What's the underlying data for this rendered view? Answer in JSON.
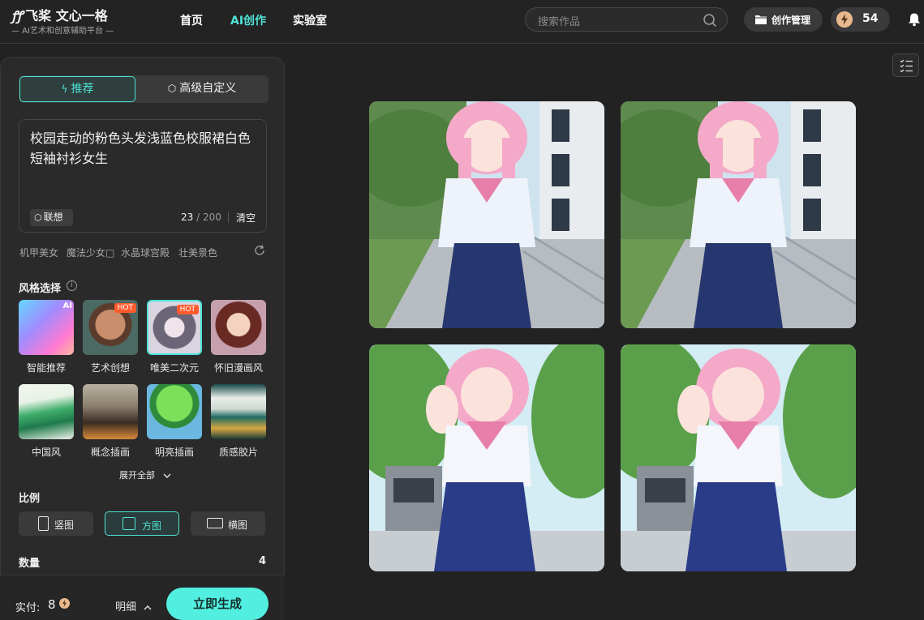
{
  "header": {
    "logo_mark": "ꝭꝭ",
    "logo_title": "飞桨 文心一格",
    "logo_subtitle": "— AI艺术和创意辅助平台 —",
    "nav": [
      {
        "label": "首页",
        "active": false
      },
      {
        "label": "AI创作",
        "active": true
      },
      {
        "label": "实验室",
        "active": false
      }
    ],
    "search_placeholder": "搜索作品",
    "manage_label": "创作管理",
    "energy_value": "54"
  },
  "panel": {
    "tabs": [
      {
        "label": "推荐",
        "icon": "bolt-icon",
        "active": true
      },
      {
        "label": "高级自定义",
        "icon": "cube-icon",
        "active": false
      }
    ],
    "prompt_text": "校园走动的粉色头发浅蓝色校服裙白色短袖衬衫女生",
    "associate_label": "联想",
    "char_count": "23",
    "char_max": "/ 200",
    "clear_label": "清空",
    "suggestions": [
      "机甲美女",
      "魔法少女□",
      "水晶球宫殿",
      "壮美景色"
    ],
    "style_title": "风格选择",
    "styles": [
      {
        "label": "智能推荐",
        "badge": "AI",
        "selected": false
      },
      {
        "label": "艺术创想",
        "badge": "HOT",
        "selected": false
      },
      {
        "label": "唯美二次元",
        "badge": "HOT",
        "selected": true
      },
      {
        "label": "怀旧漫画风",
        "badge": "",
        "selected": false
      },
      {
        "label": "中国风",
        "badge": "",
        "selected": false
      },
      {
        "label": "概念插画",
        "badge": "",
        "selected": false
      },
      {
        "label": "明亮插画",
        "badge": "",
        "selected": false
      },
      {
        "label": "质感胶片",
        "badge": "",
        "selected": false
      }
    ],
    "expand_label": "展开全部",
    "ratio_title": "比例",
    "ratios": [
      {
        "label": "竖图",
        "selected": false
      },
      {
        "label": "方图",
        "selected": true
      },
      {
        "label": "横图",
        "selected": false
      }
    ],
    "quantity_title": "数量",
    "quantity_value": "4"
  },
  "footer": {
    "cost_label": "实付:",
    "cost_value": "8",
    "detail_label": "明细",
    "generate_label": "立即生成"
  },
  "colors": {
    "accent": "#4ee3d6",
    "generate": "#52efe0",
    "hot": "#ff5b2d",
    "background": "#222222",
    "panel": "#2a2a2a"
  },
  "results": [
    "result-image-1",
    "result-image-2",
    "result-image-3",
    "result-image-4"
  ]
}
